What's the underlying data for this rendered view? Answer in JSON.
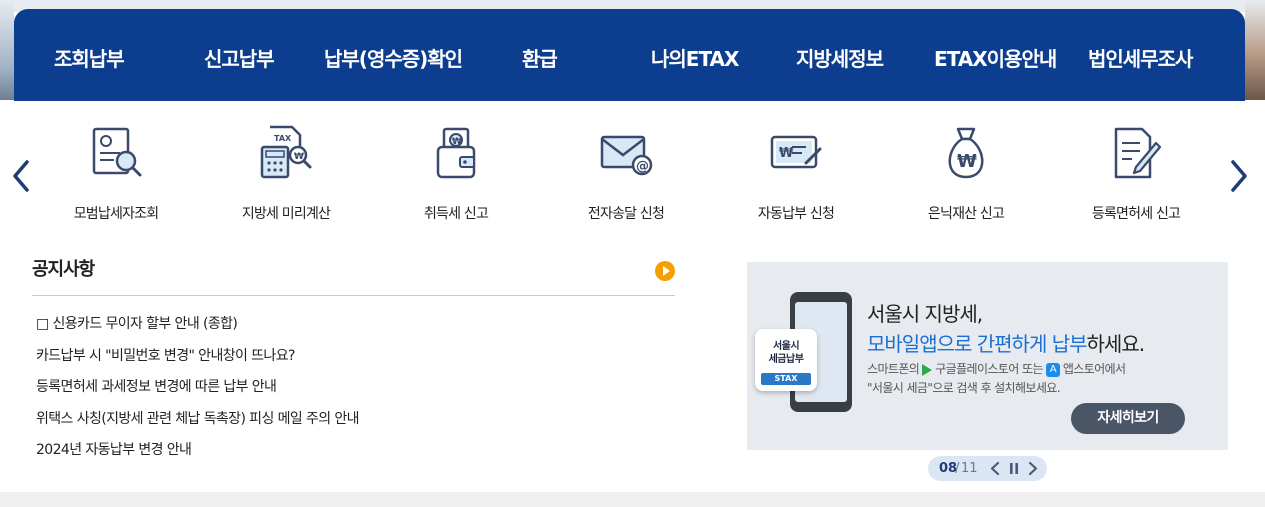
{
  "gnb": {
    "items": [
      "조회납부",
      "신고납부",
      "납부(영수증)확인",
      "환급",
      "나의ETAX",
      "지방세정보",
      "ETAX이용안내",
      "법인세무조사"
    ]
  },
  "quick_menu": {
    "items": [
      {
        "label": "모범납세자조회",
        "icon": "certificate-search-icon"
      },
      {
        "label": "지방세 미리계산",
        "icon": "tax-calculator-icon"
      },
      {
        "label": "취득세 신고",
        "icon": "wallet-won-icon"
      },
      {
        "label": "전자송달 신청",
        "icon": "email-envelope-icon"
      },
      {
        "label": "자동납부 신청",
        "icon": "card-payment-icon"
      },
      {
        "label": "은닉재산 신고",
        "icon": "money-bag-icon"
      },
      {
        "label": "등록면허세 신고",
        "icon": "document-pen-icon"
      }
    ]
  },
  "notice": {
    "title": "공지사항",
    "items": [
      "□ 신용카드 무이자 할부 안내 (종합)",
      "카드납부 시 \"비밀번호 변경\" 안내창이 뜨나요?",
      "등록면허세 과세정보 변경에 따른 납부 안내",
      "위택스 사칭(지방세 관련 체납 독촉장) 피싱 메일 주의 안내",
      "2024년 자동납부 변경 안내"
    ]
  },
  "banner": {
    "app_name_line1": "서울시",
    "app_name_line2": "세금납부",
    "app_tag": "STAX",
    "headline1": "서울시 지방세,",
    "headline2_highlight": "모바일앱으로 간편하게 납부",
    "headline2_rest": "하세요.",
    "desc_part1": "스마트폰의",
    "desc_part2": "구글플레이스토어 또는",
    "desc_part3": "앱스토어에서",
    "desc_line2": "\"서울시 세금\"으로 검색 후 설치해보세요.",
    "detail_button": "자세히보기"
  },
  "pager": {
    "current": "08",
    "separator": "/",
    "total": "11"
  },
  "colors": {
    "gnb_bg": "#0d3d8e",
    "accent_blue": "#1b6fd1",
    "more_orange": "#f5a000",
    "banner_bg": "#e7ebf0"
  }
}
